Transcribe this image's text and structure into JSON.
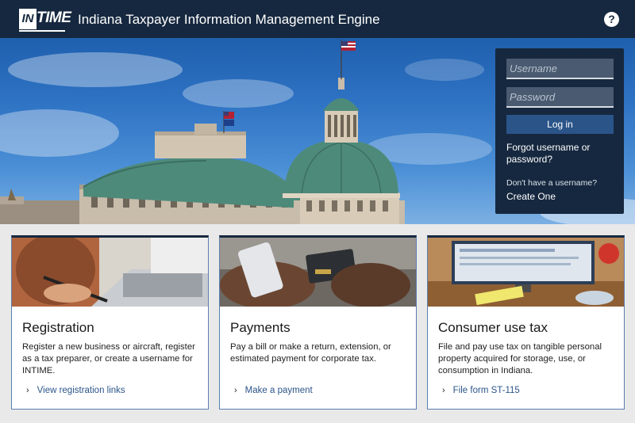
{
  "header": {
    "logo_in": "IN",
    "logo_time": "TIME",
    "title": "Indiana Taxpayer Information Management Engine",
    "help_label": "?"
  },
  "login": {
    "username_placeholder": "Username",
    "password_placeholder": "Password",
    "login_label": "Log in",
    "forgot_label": "Forgot username or password?",
    "no_username_text": "Don't have a username?",
    "create_label": "Create One"
  },
  "cards": [
    {
      "title": "Registration",
      "description": "Register a new business or aircraft, register as a tax preparer, or create a username for INTIME.",
      "link": "View registration links"
    },
    {
      "title": "Payments",
      "description": "Pay a bill or make a return, extension, or estimated payment for corporate tax.",
      "link": "Make a payment"
    },
    {
      "title": "Consumer use tax",
      "description": "File and pay use tax on tangible personal property acquired for storage, use, or consumption in Indiana.",
      "link": "File form ST-115"
    }
  ],
  "colors": {
    "navy": "#16283f",
    "link_blue": "#2b5489",
    "card_border": "#5b7fb0"
  }
}
